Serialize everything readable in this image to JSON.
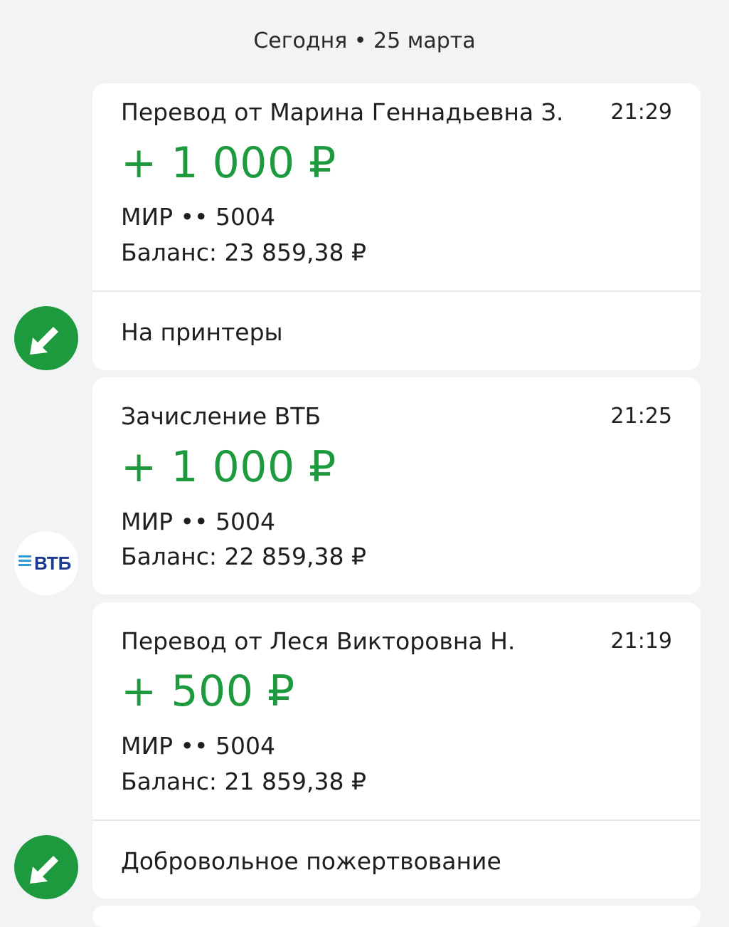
{
  "date_header": "Сегодня • 25 марта",
  "colors": {
    "accent_green": "#1e9a3e",
    "vtb_blue": "#1d3a8f",
    "vtb_light_blue": "#2f9bd6"
  },
  "transactions": [
    {
      "title": "Перевод от Марина Геннадьевна З.",
      "time": "21:29",
      "amount": "+ 1 000 ₽",
      "card": "МИР •• 5004",
      "balance": "Баланс: 23 859,38 ₽",
      "note": "На принтеры",
      "icon": "incoming-arrow-icon"
    },
    {
      "title": "Зачисление ВТБ",
      "time": "21:25",
      "amount": "+ 1 000 ₽",
      "card": "МИР •• 5004",
      "balance": "Баланс: 22 859,38 ₽",
      "icon": "vtb-logo",
      "logo_text": "ВТБ"
    },
    {
      "title": "Перевод от Леся Викторовна Н.",
      "time": "21:19",
      "amount": "+ 500 ₽",
      "card": "МИР •• 5004",
      "balance": "Баланс: 21 859,38 ₽",
      "note": "Добровольное пожертвование",
      "icon": "incoming-arrow-icon"
    }
  ]
}
